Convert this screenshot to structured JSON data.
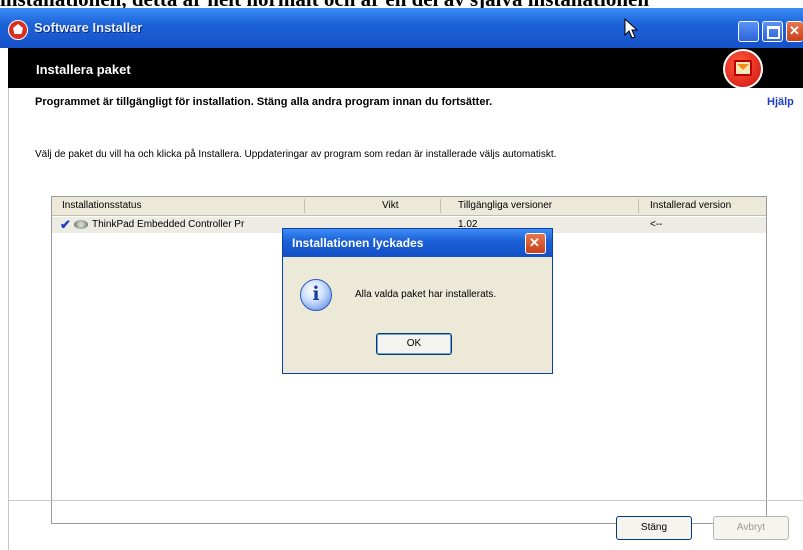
{
  "background_text": "installationen, detta är helt normalt och är en del av själva installationen",
  "window": {
    "title": "Software Installer"
  },
  "header": {
    "title": "Installera paket"
  },
  "main": {
    "instruction": "Programmet är tillgängligt för installation. Stäng alla andra program innan du fortsätter.",
    "help_link": "Hjälp",
    "description": "Välj de paket du vill ha och klicka på Installera. Uppdateringar av program som redan är installerade väljs automatiskt."
  },
  "table": {
    "columns": [
      "Installationsstatus",
      "Vikt",
      "Tillgängliga versioner",
      "Installerad version"
    ],
    "rows": [
      {
        "status": "✔",
        "name": "ThinkPad Embedded Controller Pr",
        "weight": "",
        "available_version": "1.02",
        "installed_version": "<--"
      }
    ]
  },
  "dialog": {
    "title": "Installationen lyckades",
    "message": "Alla valda paket har installerats.",
    "ok_label": "OK"
  },
  "footer": {
    "close_label": "Stäng",
    "cancel_label": "Avbryt"
  },
  "colors": {
    "titlebar": "#1d63d8",
    "header_band": "#000000",
    "help_link": "#1d3fbf",
    "check": "#1a3ec8"
  },
  "icons": {
    "app": "software-installer-icon",
    "package": "install-package-icon",
    "info": "info-icon",
    "check": "checkmark-icon"
  }
}
